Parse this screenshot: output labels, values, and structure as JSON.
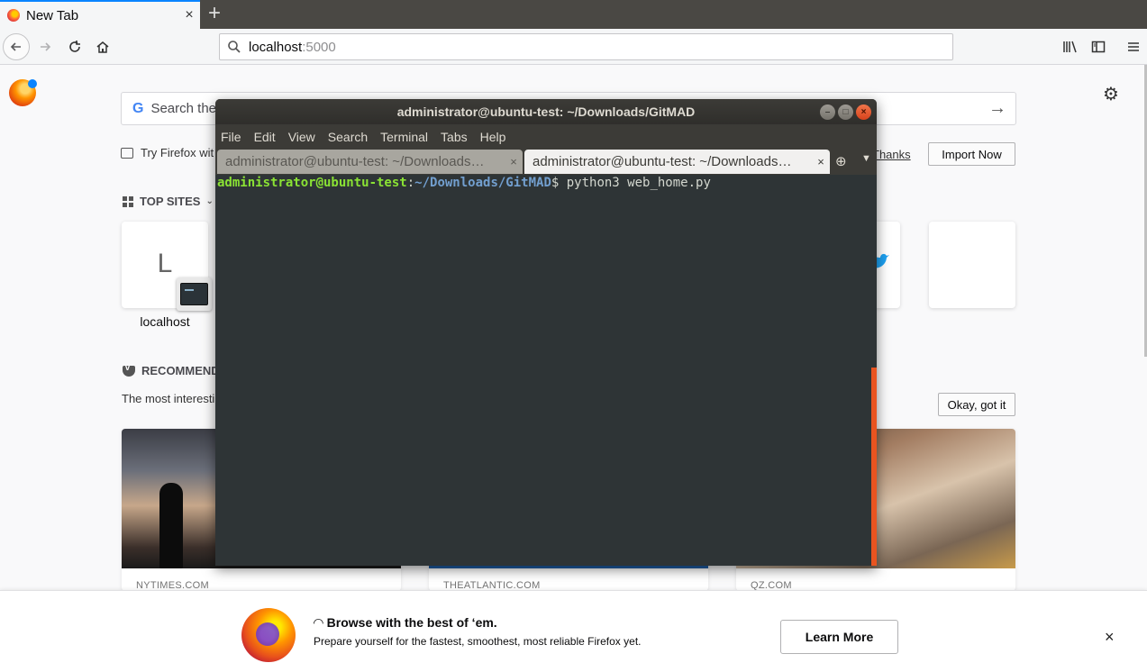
{
  "browser": {
    "tab_title": "New Tab",
    "tab_close": "×",
    "new_tab": "+",
    "url_host": "localhost",
    "url_port": ":5000"
  },
  "newtab": {
    "search_placeholder": "Search the",
    "try_text": "Try Firefox wit",
    "thanks_link": "Thanks",
    "import_button": "Import Now",
    "top_sites_heading": "TOP SITES",
    "top_site_letter": "L",
    "top_site_label": "localhost",
    "recommended_heading": "RECOMMEND",
    "recommended_sub": "The most interesti",
    "okay_button": "Okay, got it",
    "cards": [
      {
        "source": "NYTIMES.COM"
      },
      {
        "source": "THEATLANTIC.COM"
      },
      {
        "source": "QZ.COM"
      }
    ]
  },
  "snippet": {
    "title": "Browse with the best of ‘em.",
    "text": "Prepare yourself for the fastest, smoothest, most reliable Firefox yet.",
    "button": "Learn More",
    "close": "×"
  },
  "terminal": {
    "title": "administrator@ubuntu-test: ~/Downloads/GitMAD",
    "menu": [
      "File",
      "Edit",
      "View",
      "Search",
      "Terminal",
      "Tabs",
      "Help"
    ],
    "tabs": [
      {
        "label": "administrator@ubuntu-test: ~/Downloads…",
        "close": "×"
      },
      {
        "label": "administrator@ubuntu-test: ~/Downloads…",
        "close": "×"
      }
    ],
    "prompt_user": "administrator@ubuntu-test",
    "prompt_sep": ":",
    "prompt_path": "~/Downloads/GitMAD",
    "prompt_symbol": "$ ",
    "command": "python3 web_home.py"
  },
  "colors": {
    "terminal_bg": "#2e3436",
    "prompt_user": "#8ae234",
    "prompt_path": "#729fcf",
    "accent": "#0a84ff"
  }
}
